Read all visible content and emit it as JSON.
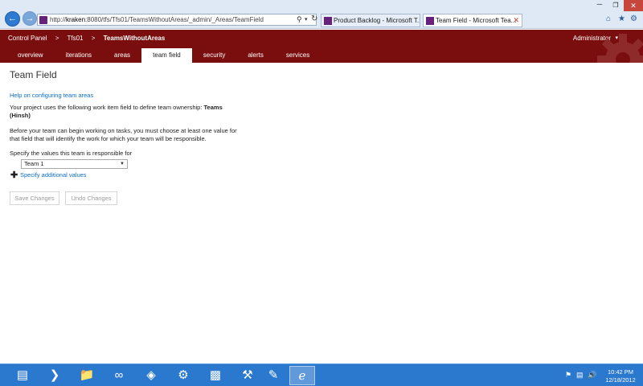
{
  "browser": {
    "url_prefix": "http://",
    "url_host": "kraken",
    "url_rest": ":8080/tfs/Tfs01/TeamsWithoutAreas/_admin/_Areas/TeamField",
    "tabs": [
      {
        "label": "Product Backlog - Microsoft T...",
        "close": "✕"
      },
      {
        "label": "Team Field - Microsoft Tea...",
        "close": "✕"
      }
    ]
  },
  "header": {
    "breadcrumb": [
      "Control Panel",
      "Tfs01",
      "TeamsWithoutAreas"
    ],
    "separator": ">",
    "user": "Administrator",
    "tabs": [
      "overview",
      "iterations",
      "areas",
      "team field",
      "security",
      "alerts",
      "services"
    ],
    "active_tab": "team field"
  },
  "main": {
    "title": "Team Field",
    "help_link": "Help on configuring team areas",
    "ownership_prefix": "Your project uses the following work item field to define team ownership: ",
    "ownership_field": "Teams (Hinsh)",
    "instruction": "Before your team can begin working on tasks, you must choose at least one value for that field that will identify the work for which your team will be responsible.",
    "specify_label": "Specify the values this team is responsible for",
    "selected_value": "Team 1",
    "add_values_link": "Specify additional values",
    "save_label": "Save Changes",
    "undo_label": "Undo Changes"
  },
  "taskbar": {
    "time": "10:42 PM",
    "date": "12/18/2012"
  },
  "colors": {
    "header_bg": "#7a0e0e",
    "link": "#0b6cc7",
    "taskbar": "#2b78cf",
    "vs_purple": "#68217a"
  }
}
